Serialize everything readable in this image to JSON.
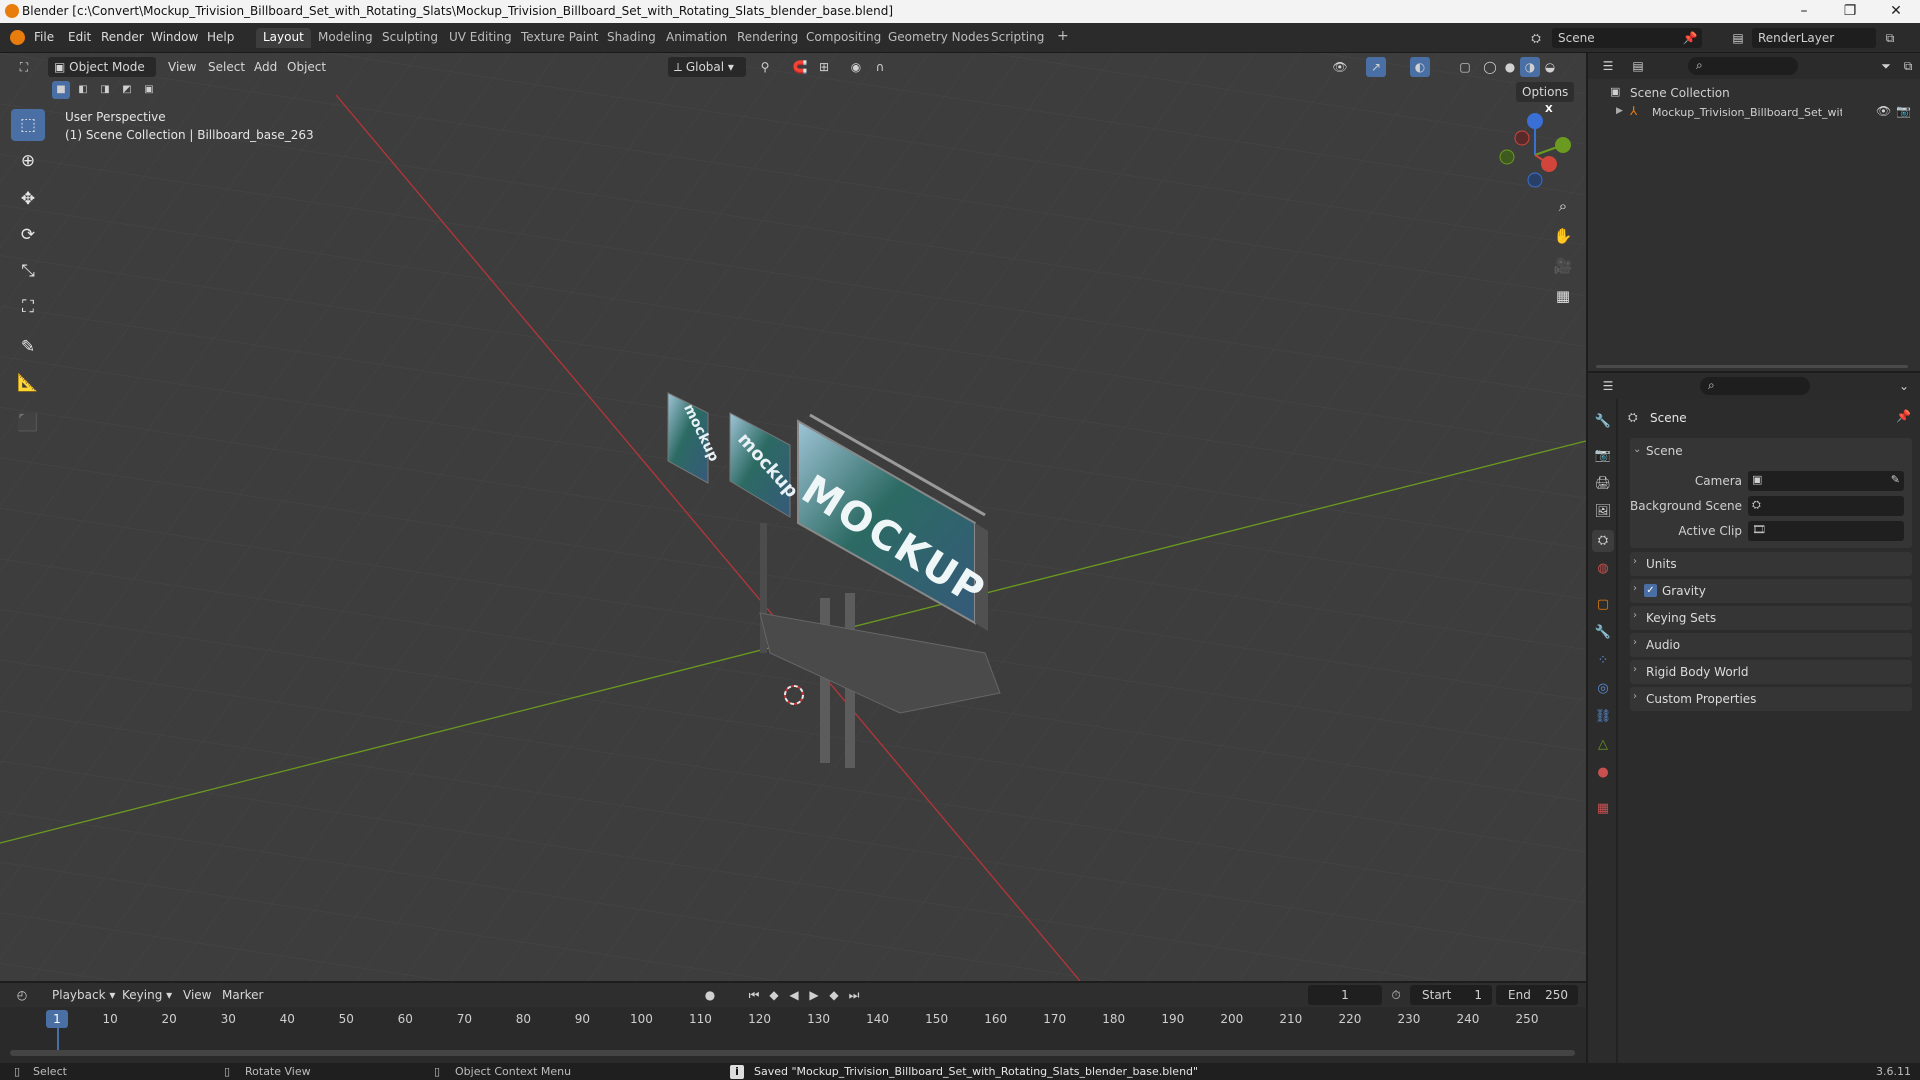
{
  "window": {
    "title": "Blender [c:\\Convert\\Mockup_Trivision_Billboard_Set_with_Rotating_Slats\\Mockup_Trivision_Billboard_Set_with_Rotating_Slats_blender_base.blend]",
    "minimize": "–",
    "maximize": "❐",
    "close": "✕"
  },
  "menu": [
    "File",
    "Edit",
    "Render",
    "Window",
    "Help"
  ],
  "workspaces": [
    "Layout",
    "Modeling",
    "Sculpting",
    "UV Editing",
    "Texture Paint",
    "Shading",
    "Animation",
    "Rendering",
    "Compositing",
    "Geometry Nodes",
    "Scripting"
  ],
  "workspace_add": "+",
  "scene_selector": "Scene",
  "view_layer": "RenderLayer",
  "viewport": {
    "mode": "Object Mode",
    "header_menus": [
      "View",
      "Select",
      "Add",
      "Object"
    ],
    "orientation": "Global",
    "options": "Options",
    "overlay_line1": "User Perspective",
    "overlay_line2": "(1) Scene Collection | Billboard_base_263",
    "billboard_texts": [
      "mockup",
      "mockup",
      "MOCKUP"
    ],
    "gizmo": {
      "x": "X",
      "y": "Y",
      "z": "Z"
    }
  },
  "outliner": {
    "search_placeholder": "",
    "root": "Scene Collection",
    "item": "Mockup_Trivision_Billboard_Set_with_Ro"
  },
  "properties": {
    "header": "Scene",
    "section": "Scene",
    "fields": [
      {
        "label": "Camera",
        "value": ""
      },
      {
        "label": "Background Scene",
        "value": ""
      },
      {
        "label": "Active Clip",
        "value": ""
      }
    ],
    "panels": [
      "Units",
      "Gravity",
      "Keying Sets",
      "Audio",
      "Rigid Body World",
      "Custom Properties"
    ],
    "gravity_checked": true
  },
  "timeline": {
    "menus": [
      "Playback",
      "Keying",
      "View",
      "Marker"
    ],
    "current_frame": "1",
    "start_label": "Start",
    "start": "1",
    "end_label": "End",
    "end": "250",
    "ticks": [
      "1",
      "10",
      "20",
      "30",
      "40",
      "50",
      "60",
      "70",
      "80",
      "90",
      "100",
      "110",
      "120",
      "130",
      "140",
      "150",
      "160",
      "170",
      "180",
      "190",
      "200",
      "210",
      "220",
      "230",
      "240",
      "250"
    ]
  },
  "status": {
    "select": "Select",
    "rotate": "Rotate View",
    "context": "Object Context Menu",
    "message": "Saved \"Mockup_Trivision_Billboard_Set_with_Rotating_Slats_blender_base.blend\"",
    "version": "3.6.11"
  },
  "colors": {
    "accent": "#4a6fa5",
    "axis_x": "#c0392b",
    "axis_y": "#6a9a1f",
    "blender_orange": "#e87d0d"
  }
}
